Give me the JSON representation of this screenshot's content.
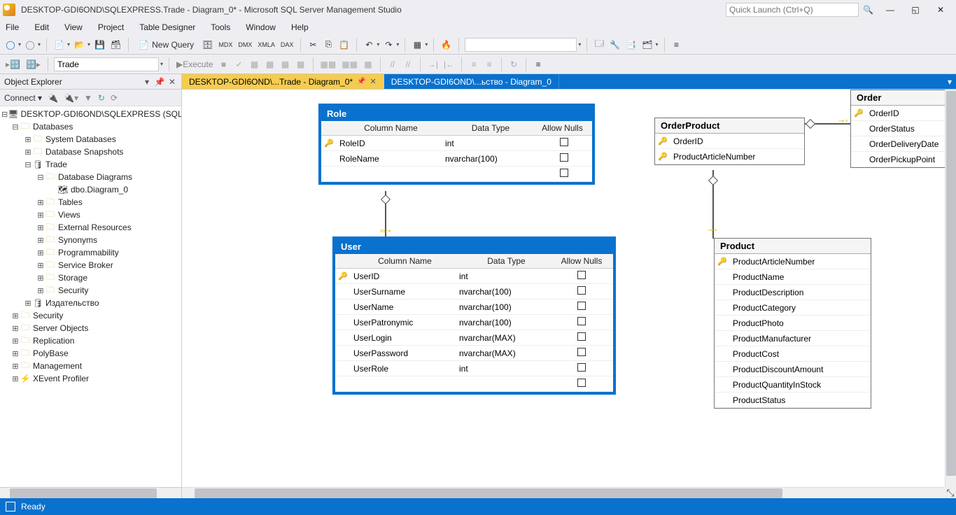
{
  "titlebar": {
    "title": "DESKTOP-GDI6OND\\SQLEXPRESS.Trade - Diagram_0* - Microsoft SQL Server Management Studio",
    "quicklaunch_placeholder": "Quick Launch (Ctrl+Q)"
  },
  "menu": [
    "File",
    "Edit",
    "View",
    "Project",
    "Table Designer",
    "Tools",
    "Window",
    "Help"
  ],
  "toolbar1": {
    "new_query": "New Query",
    "db_combo": ""
  },
  "toolbar2": {
    "db": "Trade",
    "execute": "Execute"
  },
  "object_explorer": {
    "title": "Object Explorer",
    "connect": "Connect",
    "server": "DESKTOP-GDI6OND\\SQLEXPRESS (SQL",
    "nodes": {
      "databases": "Databases",
      "sysdb": "System Databases",
      "snapshots": "Database Snapshots",
      "trade": "Trade",
      "diagrams": "Database Diagrams",
      "diagram0": "dbo.Diagram_0",
      "tables": "Tables",
      "views": "Views",
      "extres": "External Resources",
      "synonyms": "Synonyms",
      "prog": "Programmability",
      "sbroker": "Service Broker",
      "storage": "Storage",
      "security": "Security",
      "izdat": "Издательство",
      "security2": "Security",
      "serverobj": "Server Objects",
      "replication": "Replication",
      "polybase": "PolyBase",
      "management": "Management",
      "xevent": "XEvent Profiler"
    }
  },
  "tabs": [
    {
      "label": "DESKTOP-GDI6OND\\...Trade - Diagram_0*",
      "active": true,
      "pinned": true
    },
    {
      "label": "DESKTOP-GDI6OND\\...ьство - Diagram_0",
      "active": false
    }
  ],
  "diagram": {
    "headers": {
      "col": "Column Name",
      "type": "Data Type",
      "nulls": "Allow Nulls"
    },
    "role": {
      "title": "Role",
      "rows": [
        {
          "key": true,
          "name": "RoleID",
          "type": "int",
          "nulls": false
        },
        {
          "key": false,
          "name": "RoleName",
          "type": "nvarchar(100)",
          "nulls": false
        },
        {
          "key": false,
          "name": "",
          "type": "",
          "nulls": false
        }
      ]
    },
    "user": {
      "title": "User",
      "rows": [
        {
          "key": true,
          "name": "UserID",
          "type": "int",
          "nulls": false
        },
        {
          "key": false,
          "name": "UserSurname",
          "type": "nvarchar(100)",
          "nulls": false
        },
        {
          "key": false,
          "name": "UserName",
          "type": "nvarchar(100)",
          "nulls": false
        },
        {
          "key": false,
          "name": "UserPatronymic",
          "type": "nvarchar(100)",
          "nulls": false
        },
        {
          "key": false,
          "name": "UserLogin",
          "type": "nvarchar(MAX)",
          "nulls": false
        },
        {
          "key": false,
          "name": "UserPassword",
          "type": "nvarchar(MAX)",
          "nulls": false
        },
        {
          "key": false,
          "name": "UserRole",
          "type": "int",
          "nulls": false
        },
        {
          "key": false,
          "name": "",
          "type": "",
          "nulls": false
        }
      ]
    },
    "orderproduct": {
      "title": "OrderProduct",
      "rows": [
        {
          "key": true,
          "name": "OrderID"
        },
        {
          "key": true,
          "name": "ProductArticleNumber"
        }
      ]
    },
    "order": {
      "title": "Order",
      "rows": [
        {
          "key": true,
          "name": "OrderID"
        },
        {
          "key": false,
          "name": "OrderStatus"
        },
        {
          "key": false,
          "name": "OrderDeliveryDate"
        },
        {
          "key": false,
          "name": "OrderPickupPoint"
        }
      ]
    },
    "product": {
      "title": "Product",
      "rows": [
        {
          "key": true,
          "name": "ProductArticleNumber"
        },
        {
          "key": false,
          "name": "ProductName"
        },
        {
          "key": false,
          "name": "ProductDescription"
        },
        {
          "key": false,
          "name": "ProductCategory"
        },
        {
          "key": false,
          "name": "ProductPhoto"
        },
        {
          "key": false,
          "name": "ProductManufacturer"
        },
        {
          "key": false,
          "name": "ProductCost"
        },
        {
          "key": false,
          "name": "ProductDiscountAmount"
        },
        {
          "key": false,
          "name": "ProductQuantityInStock"
        },
        {
          "key": false,
          "name": "ProductStatus"
        }
      ]
    }
  },
  "status": {
    "ready": "Ready"
  }
}
